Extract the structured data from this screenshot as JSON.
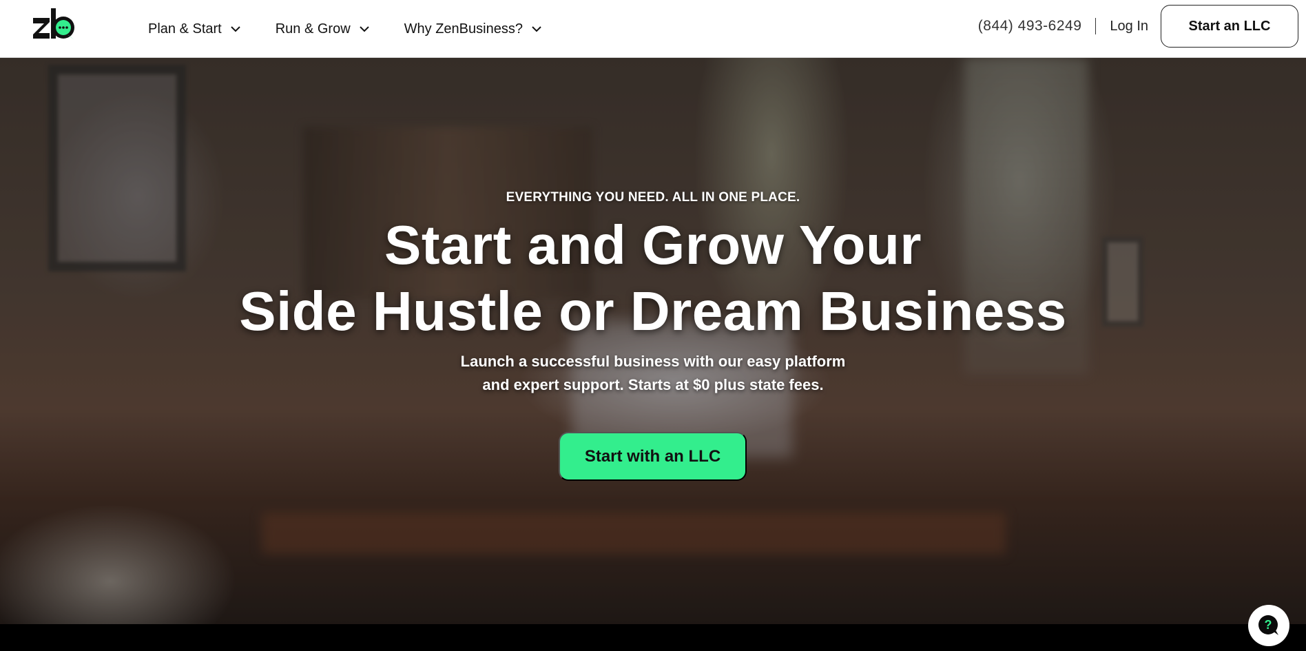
{
  "header": {
    "logo_alt": "ZenBusiness logo",
    "nav": [
      {
        "label": "Plan & Start",
        "icon": "chevron-down-icon"
      },
      {
        "label": "Run & Grow",
        "icon": "chevron-down-icon"
      },
      {
        "label": "Why ZenBusiness?",
        "icon": "chevron-down-icon"
      }
    ],
    "phone": "(844) 493-6249",
    "login_label": "Log In",
    "cta_label": "Start an LLC"
  },
  "hero": {
    "eyebrow": "EVERYTHING YOU NEED. ALL IN ONE PLACE.",
    "headline_line1": "Start and Grow Your",
    "headline_line2": "Side Hustle or Dream Business",
    "sub_line1": "Launch a successful business with our easy platform",
    "sub_line2": "and expert support. Starts at $0 plus state fees.",
    "cta_label": "Start with an LLC",
    "background": "blurred home office desk with bookshelf and window"
  },
  "help_widget": {
    "icon": "help-chat-icon",
    "glyph": "?"
  },
  "colors": {
    "accent": "#33ee8d",
    "text_dark": "#111111",
    "header_bg": "#ffffff"
  }
}
